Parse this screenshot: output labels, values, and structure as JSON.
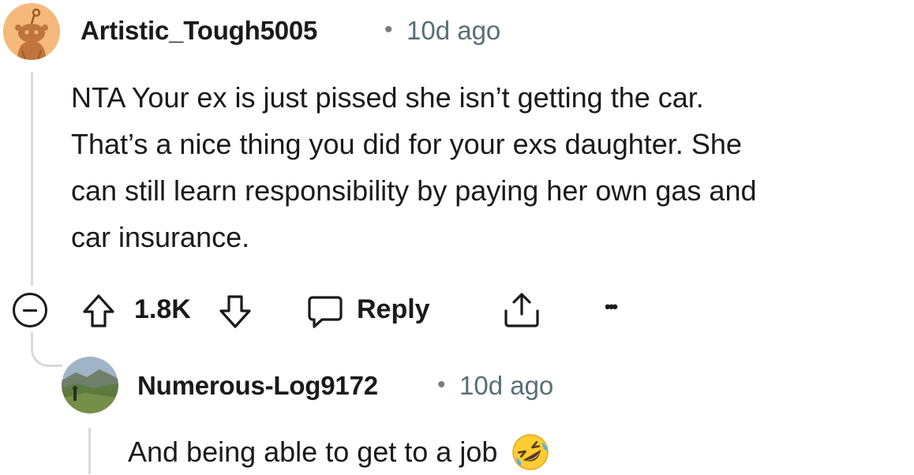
{
  "comments": [
    {
      "author": "Artistic_Tough5005",
      "separator": "•",
      "time": "10d ago",
      "body_lines": [
        "NTA Your ex is just pissed she isn’t getting the car.",
        "That’s a nice thing you did for your exs daughter. She",
        "can still learn responsibility by paying her own gas and",
        "car insurance."
      ],
      "avatar_icon": "reddit-snoo-avatar",
      "actions": {
        "collapse_icon": "collapse-minus-icon",
        "upvote_icon": "upvote-arrow-icon",
        "score": "1.8K",
        "downvote_icon": "downvote-arrow-icon",
        "reply_icon": "speech-bubble-icon",
        "reply_label": "Reply",
        "share_icon": "share-icon",
        "more_label": "•••"
      }
    },
    {
      "author": "Numerous-Log9172",
      "separator": "•",
      "time": "10d ago",
      "body": "And being able to get to a job",
      "emoji_icon": "rolling-on-floor-laughing-emoji",
      "avatar_icon": "landscape-photo-avatar"
    }
  ],
  "colors": {
    "text": "#1a1a1b",
    "meta": "#576f76",
    "thread_line": "#d7dadc",
    "avatar_bg": "#f5b97c"
  }
}
